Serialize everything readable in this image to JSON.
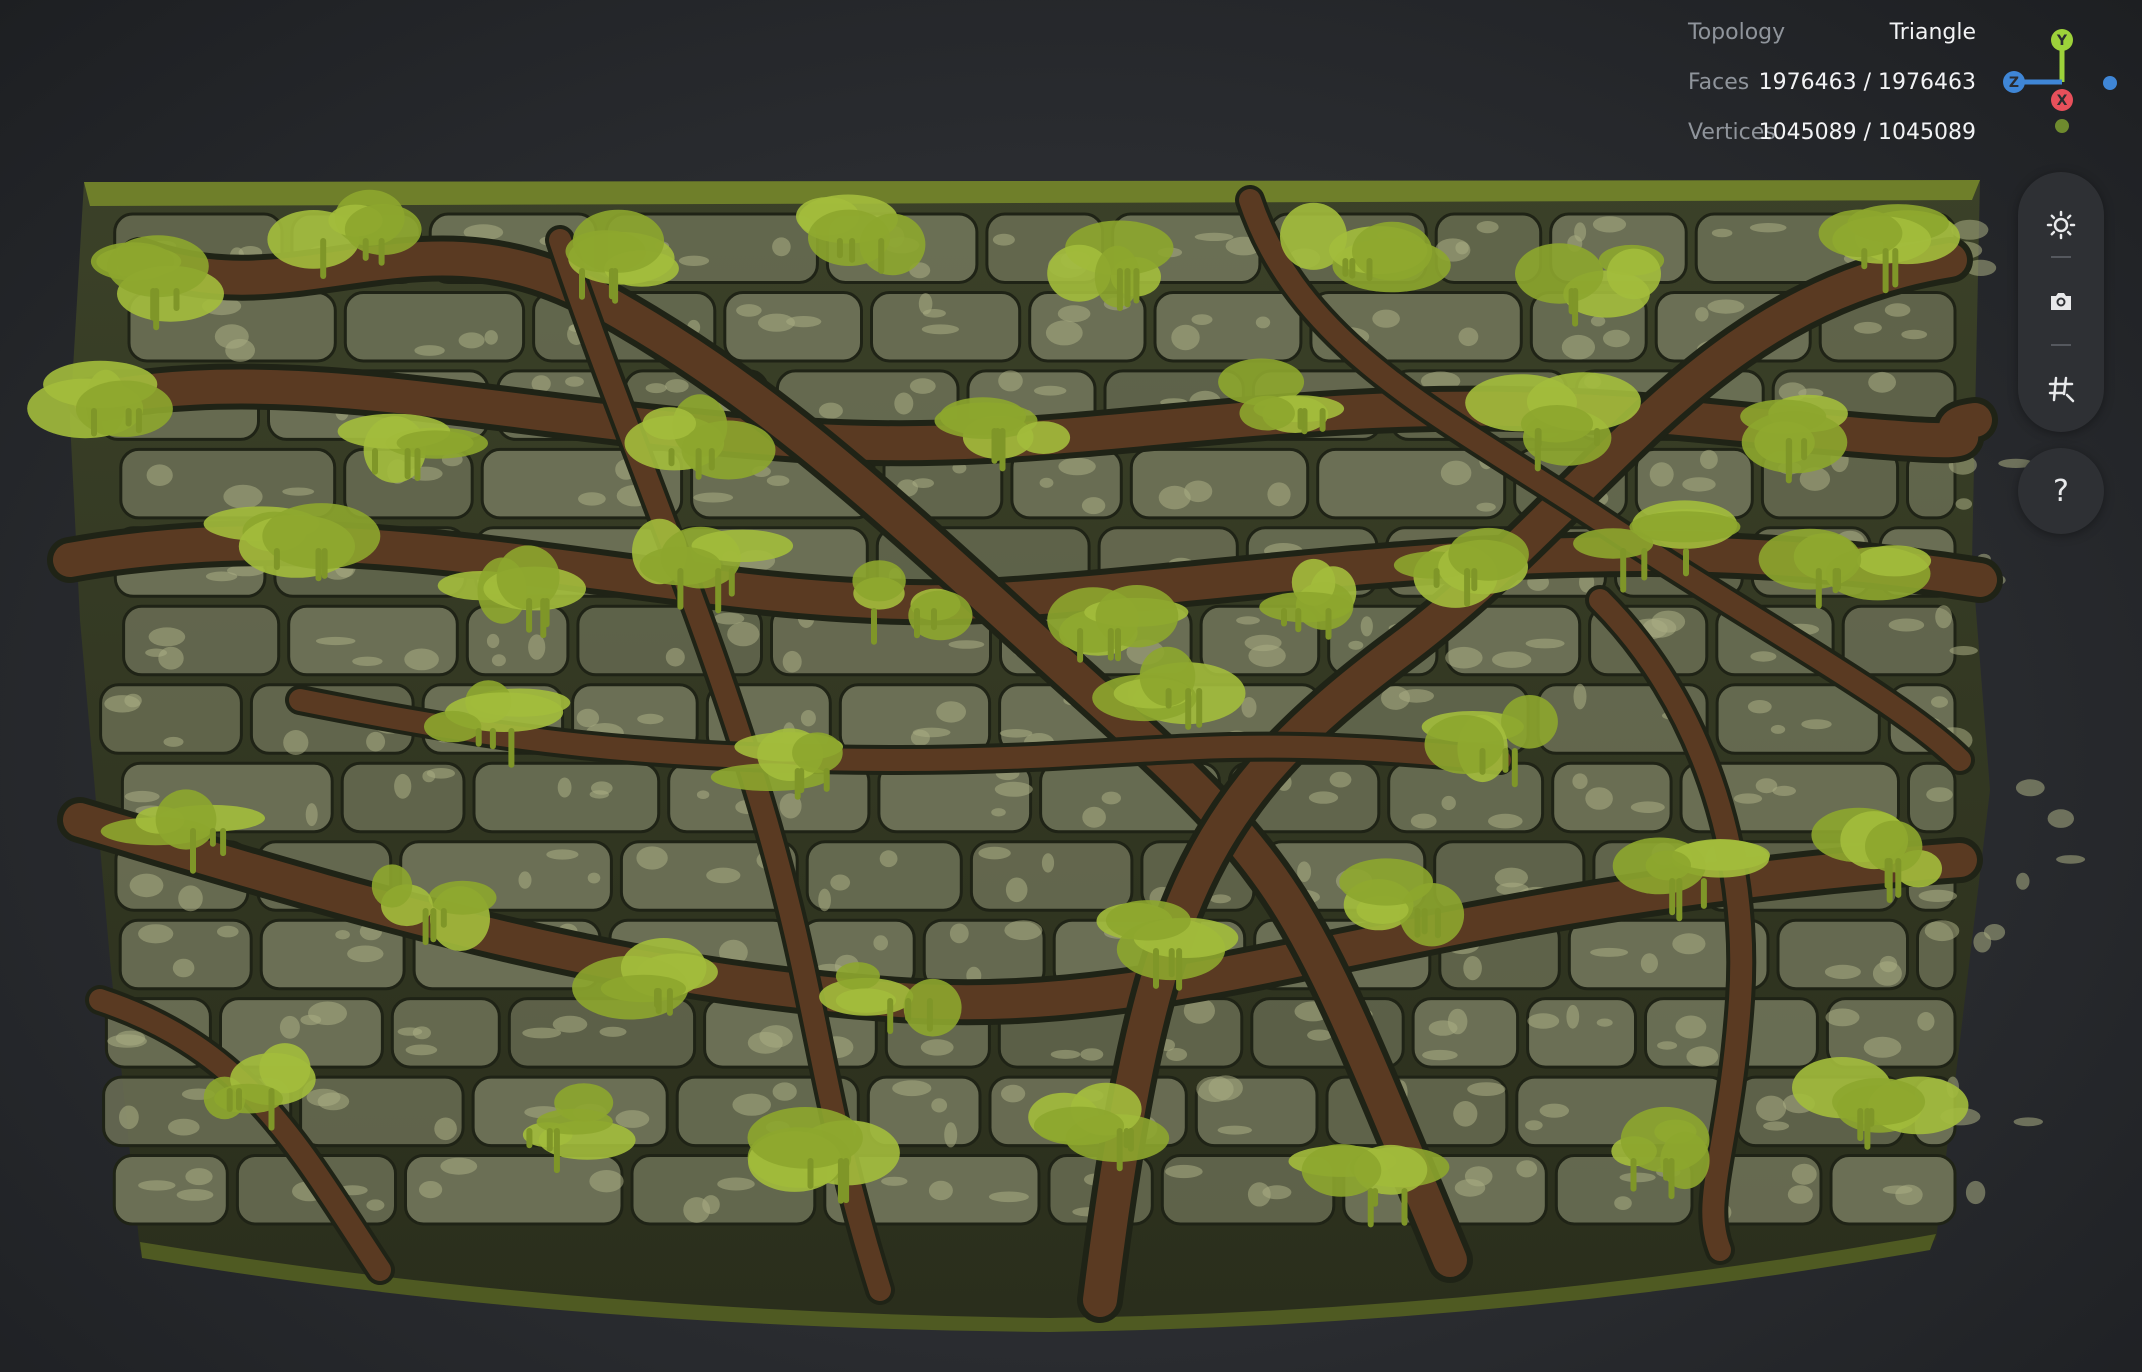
{
  "viewer": {
    "stats": [
      {
        "label": "Topology",
        "value": "Triangle"
      },
      {
        "label": "Faces",
        "value": "1976463 / 1976463"
      },
      {
        "label": "Vertices",
        "value": "1045089 / 1045089"
      }
    ],
    "axis_gizmo": {
      "y_label": "Y",
      "z_label": "Z",
      "x_label": "X",
      "colors": {
        "y": "#9dd23a",
        "z": "#3f86d6",
        "x": "#e8505b"
      }
    },
    "toolbar": {
      "items": [
        {
          "icon": "sun-icon",
          "name": "lighting"
        },
        {
          "icon": "camera-icon",
          "name": "screenshot"
        },
        {
          "icon": "grid-icon",
          "name": "grid-toggle"
        }
      ],
      "help_label": "?"
    },
    "model": {
      "subject": "mossy stone wall with tree roots",
      "colors": {
        "moss": "#8da62e",
        "stone": "#6b6f55",
        "root": "#5a3a22",
        "shadow": "#1f2316"
      }
    }
  }
}
